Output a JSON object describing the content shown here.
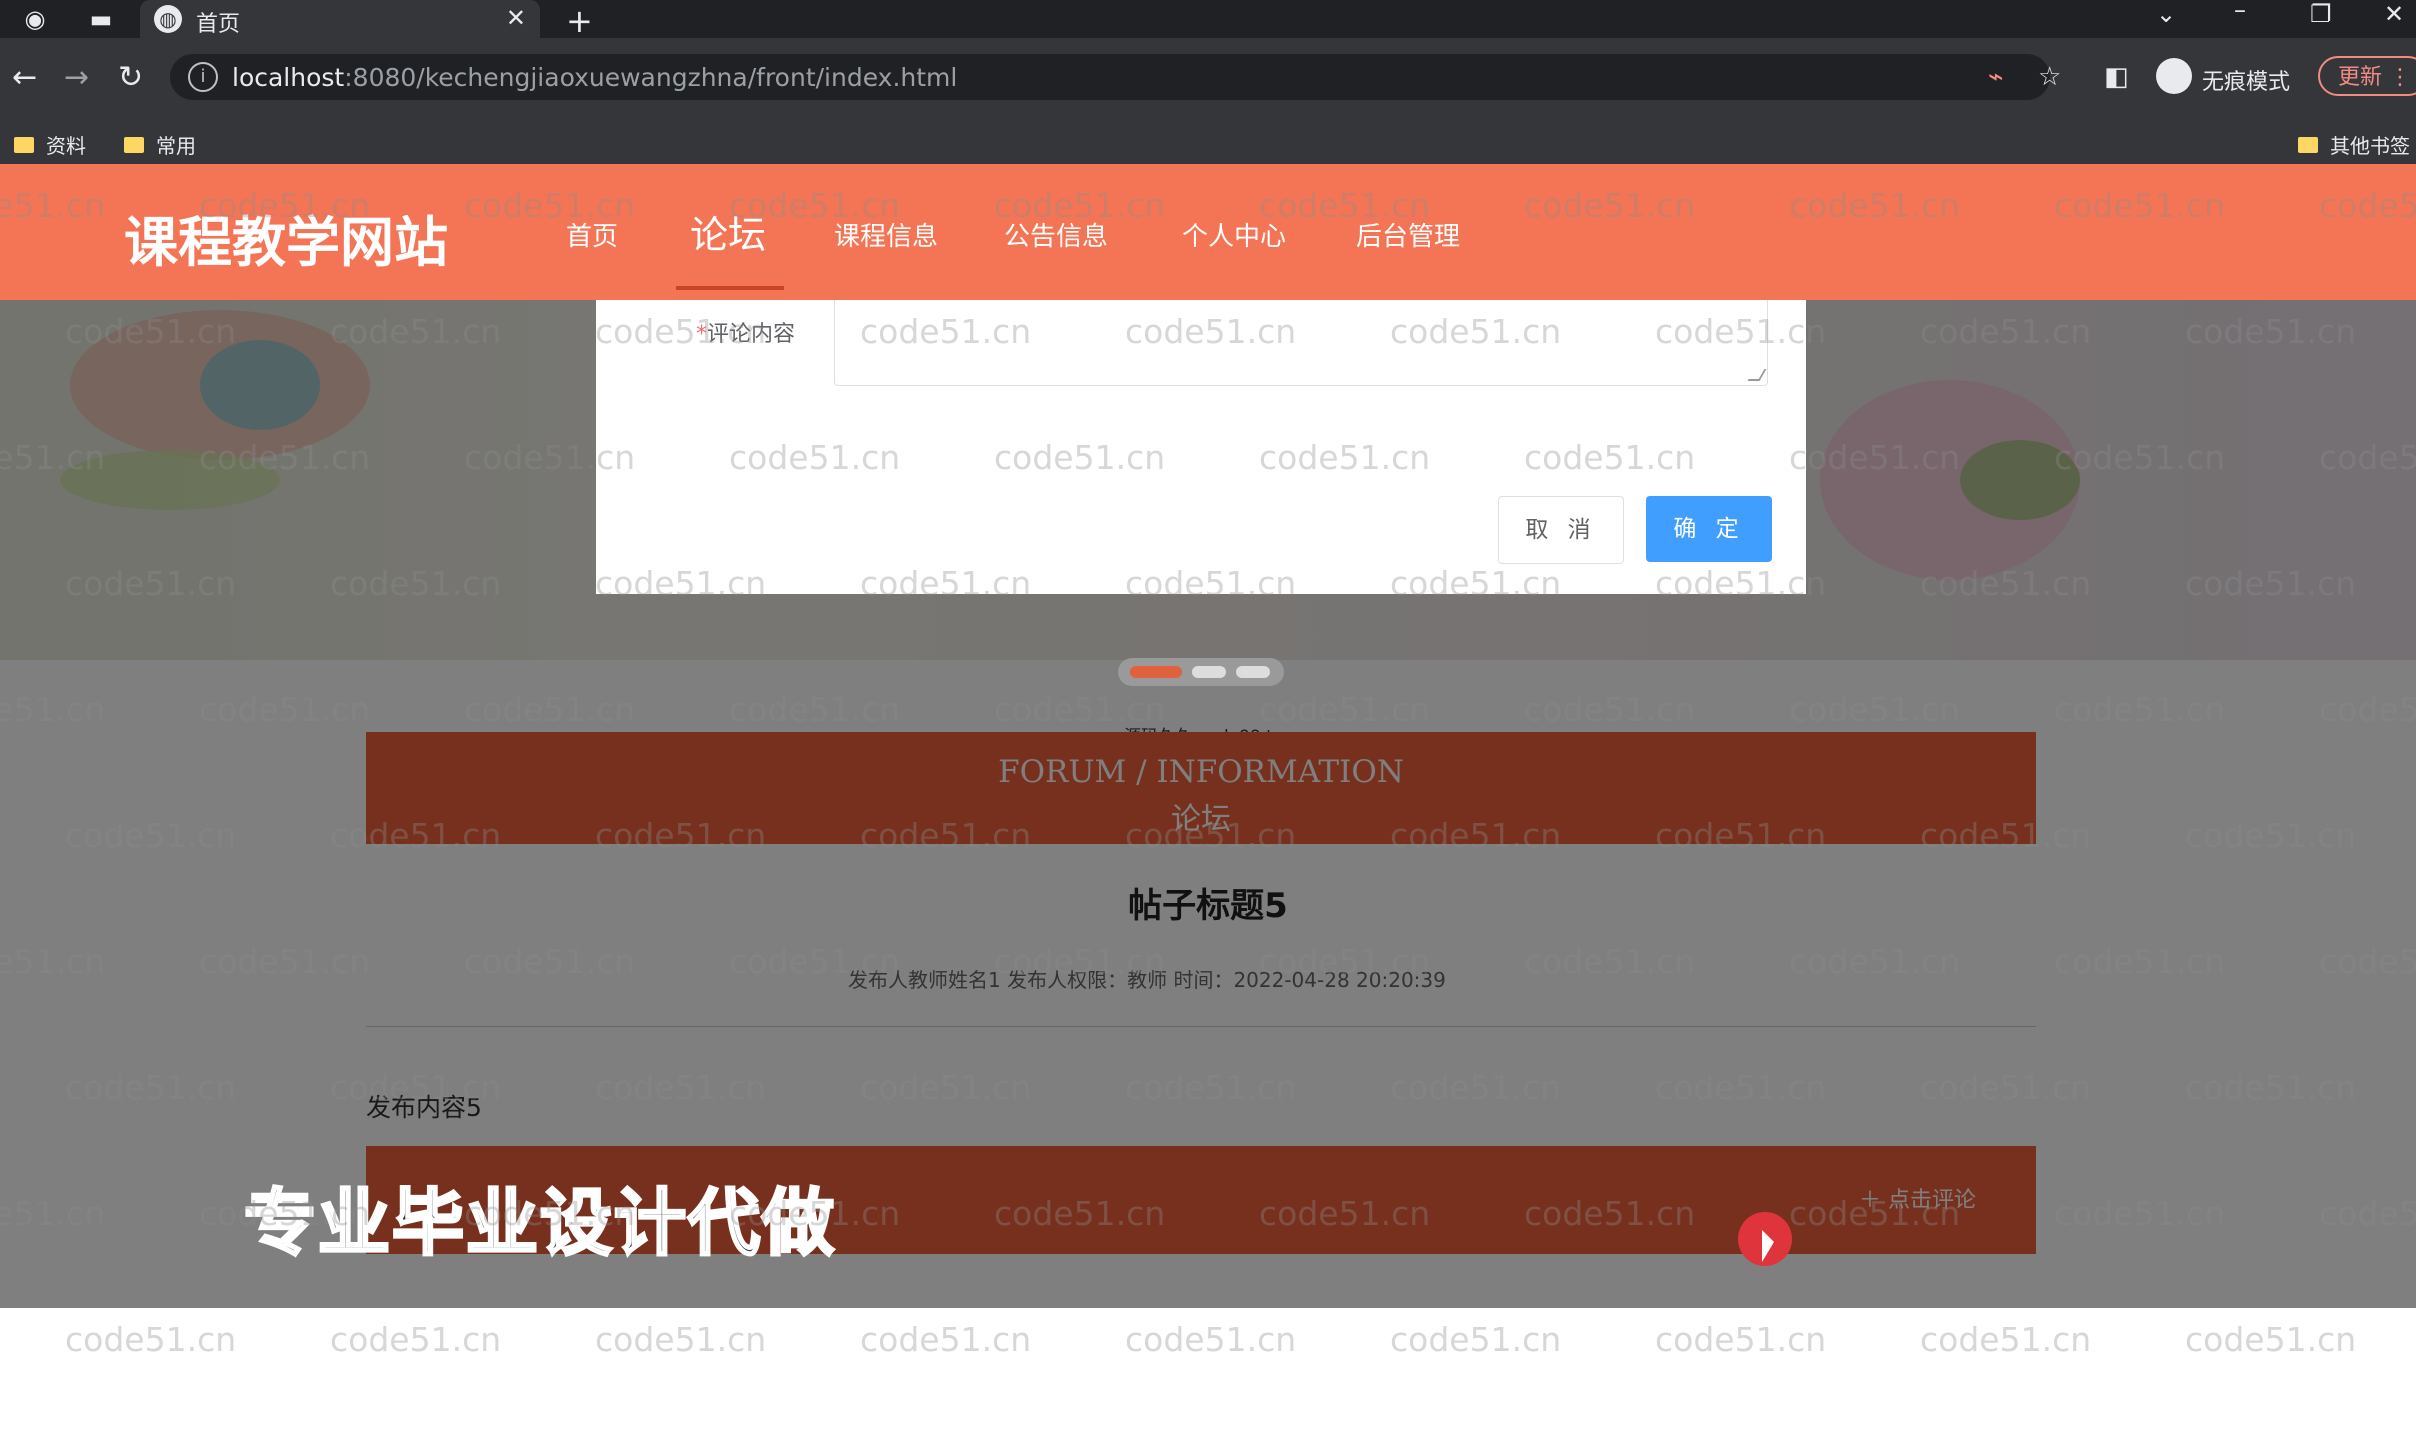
{
  "browser": {
    "tab_title": "首页",
    "url_host": "localhost",
    "url_rest": ":8080/kechengjiaoxuewangzhna/front/index.html",
    "incognito_label": "无痕模式",
    "update_label": "更新",
    "bookmarks": [
      "资料",
      "常用"
    ],
    "other_bookmarks": "其他书签"
  },
  "site": {
    "logo": "课程教学网站",
    "nav": [
      "首页",
      "论坛",
      "课程信息",
      "公告信息",
      "个人中心",
      "后台管理"
    ],
    "active_nav": "论坛"
  },
  "modal": {
    "label_required": "*",
    "label": "评论内容",
    "textarea_value": "",
    "cancel_label": "取 消",
    "confirm_label": "确 定"
  },
  "section": {
    "source_note": "源码久久-code99.top",
    "title_en": "FORUM / INFORMATION",
    "title_zh": "论坛"
  },
  "post": {
    "title": "帖子标题5",
    "meta": "发布人教师姓名1   发布人权限：教师   时间：2022-04-28 20:20:39",
    "content": "发布内容5",
    "comment_button": "点击评论"
  },
  "promo_text": "专业毕业设计代做",
  "watermark": "code51.cn",
  "colors": {
    "header": "#f47555",
    "forum_bar": "#f0603d",
    "primary_button": "#409eff"
  }
}
